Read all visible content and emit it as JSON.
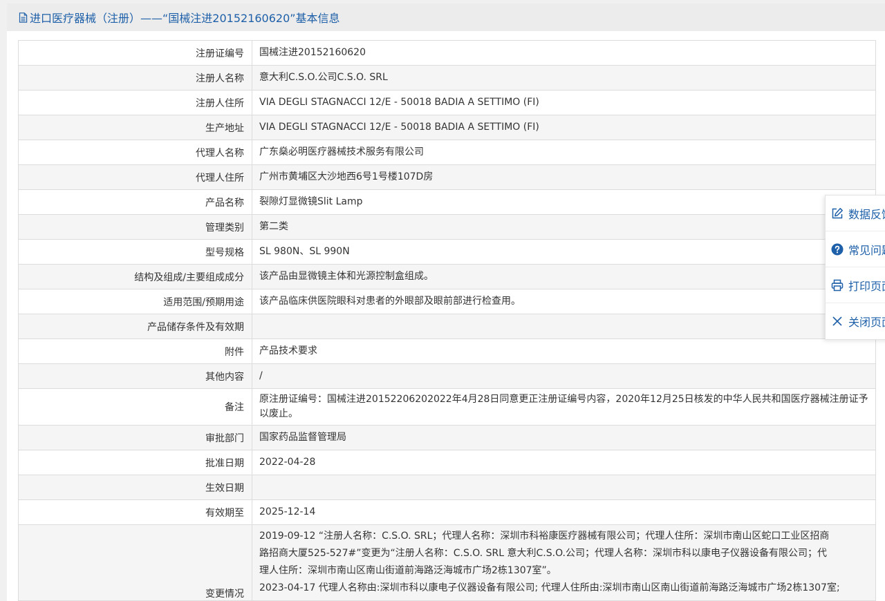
{
  "header": {
    "title": "进口医疗器械（注册）——“国械注进20152160620”基本信息",
    "icon": "document-icon"
  },
  "rows": [
    {
      "label": "注册证编号",
      "value": "国械注进20152160620"
    },
    {
      "label": "注册人名称",
      "value": "意大利C.S.O.公司C.S.O. SRL"
    },
    {
      "label": "注册人住所",
      "value": "VIA DEGLI STAGNACCI 12/E - 50018 BADIA A SETTIMO (FI)"
    },
    {
      "label": "生产地址",
      "value": "VIA DEGLI STAGNACCI 12/E - 50018 BADIA A SETTIMO (FI)"
    },
    {
      "label": "代理人名称",
      "value": "广东燊必明医疗器械技术服务有限公司"
    },
    {
      "label": "代理人住所",
      "value": "广州市黄埔区大沙地西6号1号楼107D房"
    },
    {
      "label": "产品名称",
      "value": "裂隙灯显微镜Slit Lamp"
    },
    {
      "label": "管理类别",
      "value": "第二类"
    },
    {
      "label": "型号规格",
      "value": "SL 980N、SL 990N"
    },
    {
      "label": "结构及组成/主要组成成分",
      "value": "该产品由显微镜主体和光源控制盒组成。"
    },
    {
      "label": "适用范围/预期用途",
      "value": "该产品临床供医院眼科对患者的外眼部及眼前部进行检查用。"
    },
    {
      "label": "产品储存条件及有效期",
      "value": ""
    },
    {
      "label": "附件",
      "value": "产品技术要求"
    },
    {
      "label": "其他内容",
      "value": "/"
    },
    {
      "label": "备注",
      "value": "原注册证编号：国械注进20152206202022年4月28日同意更正注册证编号内容，2020年12月25日核发的中华人民共和国医疗器械注册证予以废止。"
    },
    {
      "label": "审批部门",
      "value": "国家药品监督管理局"
    },
    {
      "label": "批准日期",
      "value": "2022-04-28"
    },
    {
      "label": "生效日期",
      "value": ""
    },
    {
      "label": "有效期至",
      "value": "2025-12-14"
    }
  ],
  "change_row": {
    "label": "变更情况",
    "lines": [
      "2019-09-12 “注册人名称：C.S.O. SRL；代理人名称：深圳市科裕康医疗器械有限公司；代理人住所：深圳市南山区蛇口工业区招商",
      "路招商大厦525-527#”变更为“注册人名称：C.S.O. SRL 意大利C.S.O.公司；代理人名称：深圳市科以康电子仪器设备有限公司；代",
      "理人住所：深圳市南山区南山街道前海路泛海城市广场2栋1307室”。",
      "2023-04-17 代理人名称由:深圳市科以康电子仪器设备有限公司; 代理人住所由:深圳市南山区南山街道前海路泛海城市广场2栋1307室;"
    ]
  },
  "float_menu": {
    "items": [
      {
        "label": "数据反馈",
        "icon": "edit-icon"
      },
      {
        "label": "常见问题",
        "icon": "question-icon"
      },
      {
        "label": "打印页面",
        "icon": "printer-icon"
      },
      {
        "label": "关闭页面",
        "icon": "close-icon"
      }
    ]
  },
  "colors": {
    "accent": "#1d5fa8",
    "header_bg": "#ececec",
    "row_alt": "#f5f5f5",
    "border": "#dcdcdc"
  }
}
